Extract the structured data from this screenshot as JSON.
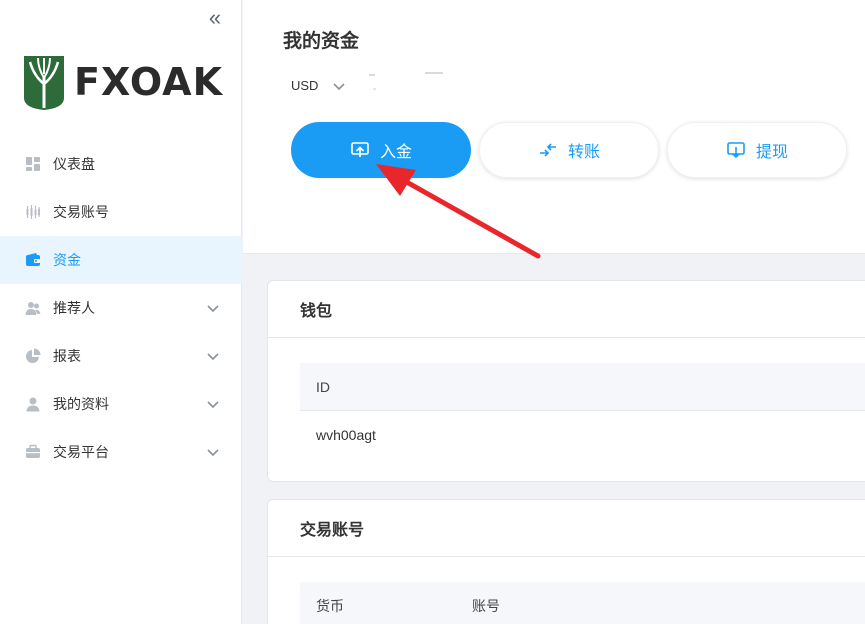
{
  "sidebar": {
    "collapse_glyph": "«",
    "logo_text": "FXOAK",
    "items": [
      {
        "label": "仪表盘",
        "icon": "dashboard-icon",
        "has_children": false,
        "active": false
      },
      {
        "label": "交易账号",
        "icon": "candlestick-icon",
        "has_children": false,
        "active": false
      },
      {
        "label": "资金",
        "icon": "wallet-icon",
        "has_children": false,
        "active": true
      },
      {
        "label": "推荐人",
        "icon": "users-icon",
        "has_children": true,
        "active": false
      },
      {
        "label": "报表",
        "icon": "pie-chart-icon",
        "has_children": true,
        "active": false
      },
      {
        "label": "我的资料",
        "icon": "user-icon",
        "has_children": true,
        "active": false
      },
      {
        "label": "交易平台",
        "icon": "briefcase-icon",
        "has_children": true,
        "active": false
      }
    ]
  },
  "header": {
    "title": "我的资金",
    "currency": "USD"
  },
  "actions": {
    "deposit": "入金",
    "transfer": "转账",
    "withdraw": "提现"
  },
  "wallet": {
    "title": "钱包",
    "columns": [
      "ID"
    ],
    "rows": [
      [
        "wvh00agt"
      ]
    ]
  },
  "accounts": {
    "title": "交易账号",
    "columns": [
      "货币",
      "账号"
    ]
  },
  "colors": {
    "accent": "#1a9cf5",
    "active_bg": "#e8f4fe",
    "annotation_arrow": "#e8262c",
    "logo_green": "#2e6b3a"
  }
}
